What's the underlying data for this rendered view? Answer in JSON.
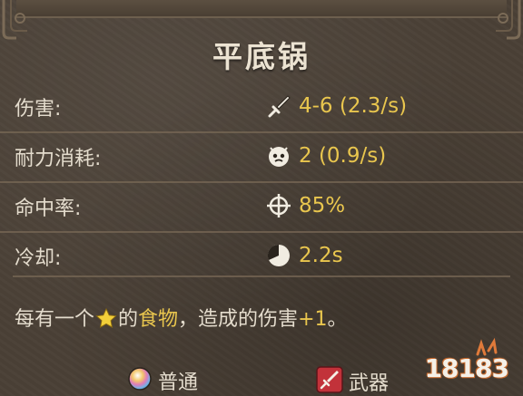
{
  "item": {
    "name": "平底锅"
  },
  "stats": [
    {
      "label": "伤害:",
      "icon": "sword-icon",
      "value": "4-6 (2.3/s)"
    },
    {
      "label": "耐力消耗:",
      "icon": "stamina-face-icon",
      "value": "2 (0.9/s)"
    },
    {
      "label": "命中率:",
      "icon": "crosshair-icon",
      "value": "85%"
    },
    {
      "label": "冷却:",
      "icon": "cooldown-clock-icon",
      "value": "2.2s"
    }
  ],
  "effect": {
    "prefix": "每有一个",
    "star_icon": "star-icon",
    "middle": "的",
    "keyword": "食物",
    "suffix": "，造成的伤害",
    "bonus": "+1",
    "end": "。"
  },
  "tags": {
    "rarity": {
      "label": "普通",
      "icon": "rarity-orb-icon"
    },
    "type": {
      "label": "武器",
      "icon": "weapon-badge-icon"
    }
  },
  "watermark": {
    "text": "18183"
  },
  "colors": {
    "panel": "#4a4036",
    "text": "#e4dccd",
    "highlight": "#e9c64e",
    "divider": "#786856"
  }
}
